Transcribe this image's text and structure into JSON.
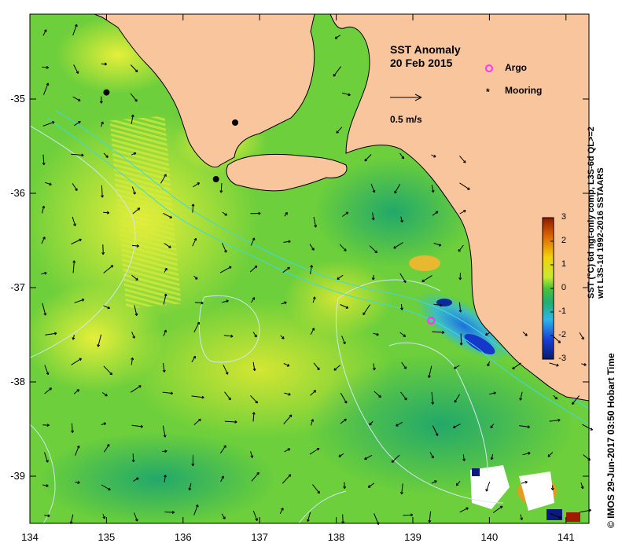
{
  "map": {
    "title": "SST Anomaly",
    "date": "20 Feb 2015",
    "x_ticks": [
      "134",
      "135",
      "136",
      "137",
      "138",
      "139",
      "140",
      "141"
    ],
    "y_ticks": [
      "-35",
      "-36",
      "-37",
      "-38",
      "-39"
    ],
    "lon_range": [
      134,
      141.3
    ],
    "lat_range": [
      -34.1,
      -39.5
    ],
    "vector_scale_label": "0.5 m/s",
    "colors": {
      "land": "#f9c59d",
      "ocean_base": "#6ccf3b",
      "contour": "#cfe8f0",
      "argo": "#ff33ff",
      "mooring": "#000000"
    }
  },
  "legend": {
    "argo_label": "Argo",
    "mooring_label": "Mooring"
  },
  "colorbar": {
    "ticks": [
      "3",
      "2",
      "1",
      "0",
      "-1",
      "-2",
      "-3"
    ],
    "range": [
      -3,
      3
    ],
    "caption_line1": "SST (°C) 6d ngt-only comp, L3S-6d QL>=2",
    "caption_line2": "wrt L3S-1d 1992-2016 SSTAARS"
  },
  "credit": "© IMOS 29-Jun-2017 03:50 Hobart Time",
  "markers": {
    "moorings": [
      {
        "lon": 135.0,
        "lat": -34.93
      },
      {
        "lon": 136.68,
        "lat": -35.25
      },
      {
        "lon": 136.43,
        "lat": -35.85
      }
    ],
    "argo": [
      {
        "lon": 139.24,
        "lat": -37.35
      }
    ]
  }
}
